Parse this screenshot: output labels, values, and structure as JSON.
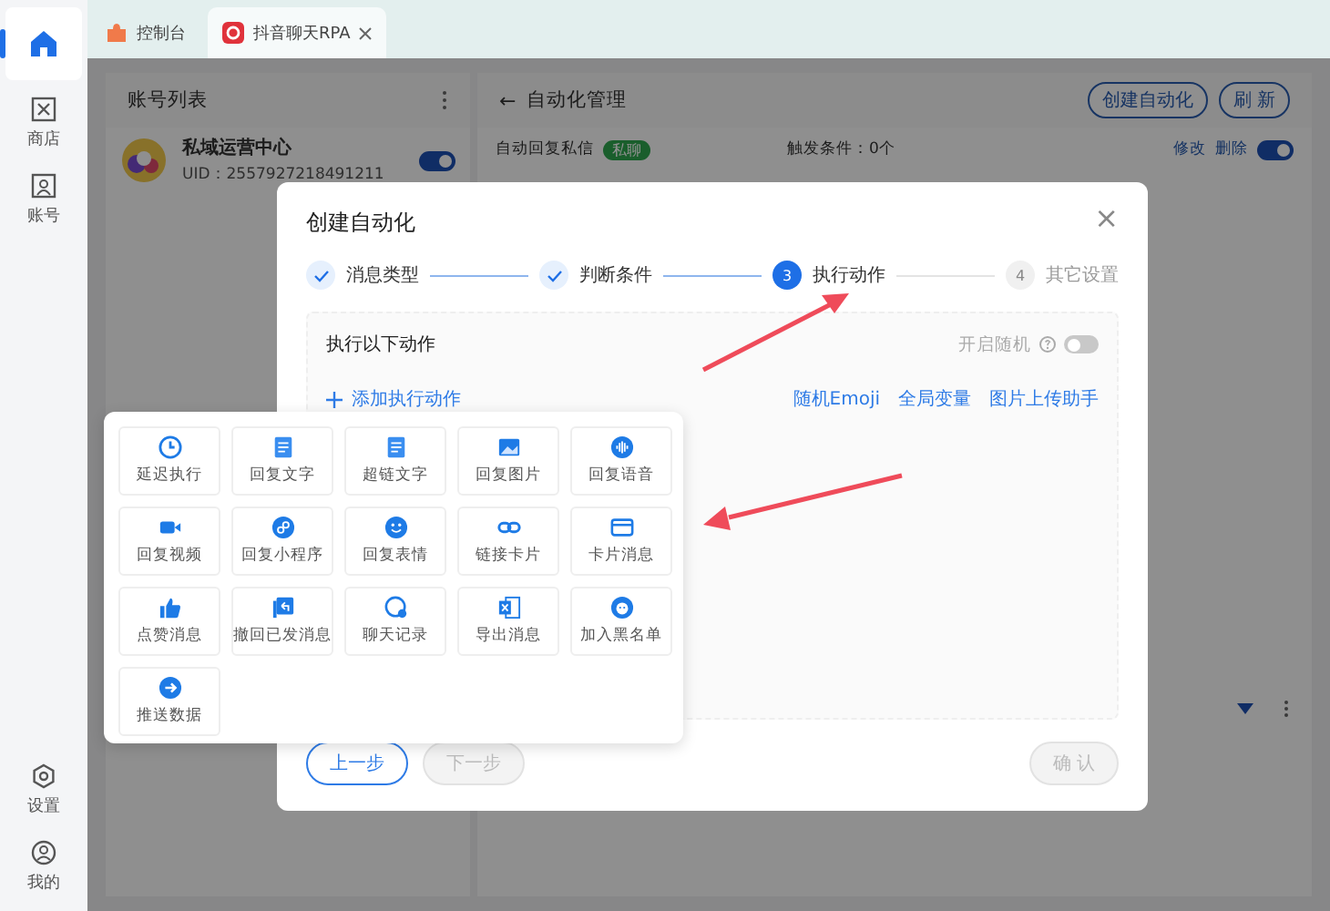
{
  "sidebar": {
    "items": [
      {
        "selected": true
      },
      {
        "label": "商店",
        "selected": false
      },
      {
        "label": "账号",
        "selected": false
      }
    ],
    "bottom_items": [
      {
        "label": "设置"
      },
      {
        "label": "我的"
      }
    ]
  },
  "tabs": [
    {
      "label": "控制台",
      "closable": false,
      "selected": false
    },
    {
      "label": "抖音聊天RPA",
      "closable": true,
      "selected": true
    }
  ],
  "account_panel": {
    "title": "账号列表",
    "accounts": [
      {
        "name": "私域运营中心",
        "uid": "UID：2557927218491211",
        "on": true
      }
    ]
  },
  "automation_panel": {
    "title": "自动化管理",
    "back": "←",
    "buttons": [
      "创建自动化",
      "刷 新"
    ],
    "rules": [
      {
        "name": "自动回复私信",
        "tag": "私聊",
        "trigger": "触发条件：0个",
        "actions": [
          "修改",
          "删除"
        ],
        "on": true
      }
    ]
  },
  "dialog": {
    "title": "创建自动化",
    "close": "×",
    "steps": [
      {
        "label": "消息类型",
        "done": true,
        "selected": false
      },
      {
        "label": "判断条件",
        "done": true,
        "selected": false
      },
      {
        "number": "3",
        "label": "执行动作",
        "done": false,
        "selected": true
      },
      {
        "number": "4",
        "label": "其它设置",
        "done": false,
        "selected": false
      }
    ],
    "section_title": "执行以下动作",
    "random_label": "开启随机",
    "random_on": false,
    "add_action": "添加执行动作",
    "links": [
      "随机Emoji",
      "全局变量",
      "图片上传助手"
    ],
    "footer": [
      {
        "label": "上一步",
        "disabled": false
      },
      {
        "label": "下一步",
        "disabled": true
      }
    ],
    "confirm": {
      "label": "确 认",
      "disabled": true
    }
  },
  "action_menu": [
    {
      "kind": "clock",
      "label": "延迟执行"
    },
    {
      "kind": "text",
      "label": "回复文字"
    },
    {
      "kind": "text",
      "label": "超链文字"
    },
    {
      "kind": "image",
      "label": "回复图片"
    },
    {
      "kind": "voice",
      "label": "回复语音"
    },
    {
      "kind": "video",
      "label": "回复视频"
    },
    {
      "kind": "miniapp",
      "label": "回复小程序"
    },
    {
      "kind": "emoji",
      "label": "回复表情"
    },
    {
      "kind": "link",
      "label": "链接卡片"
    },
    {
      "kind": "card",
      "label": "卡片消息"
    },
    {
      "kind": "like",
      "label": "点赞消息"
    },
    {
      "kind": "recall",
      "label": "撤回已发消息"
    },
    {
      "kind": "chat",
      "label": "聊天记录"
    },
    {
      "kind": "excel",
      "label": "导出消息"
    },
    {
      "kind": "block",
      "label": "加入黑名单"
    },
    {
      "kind": "push",
      "label": "推送数据"
    }
  ]
}
